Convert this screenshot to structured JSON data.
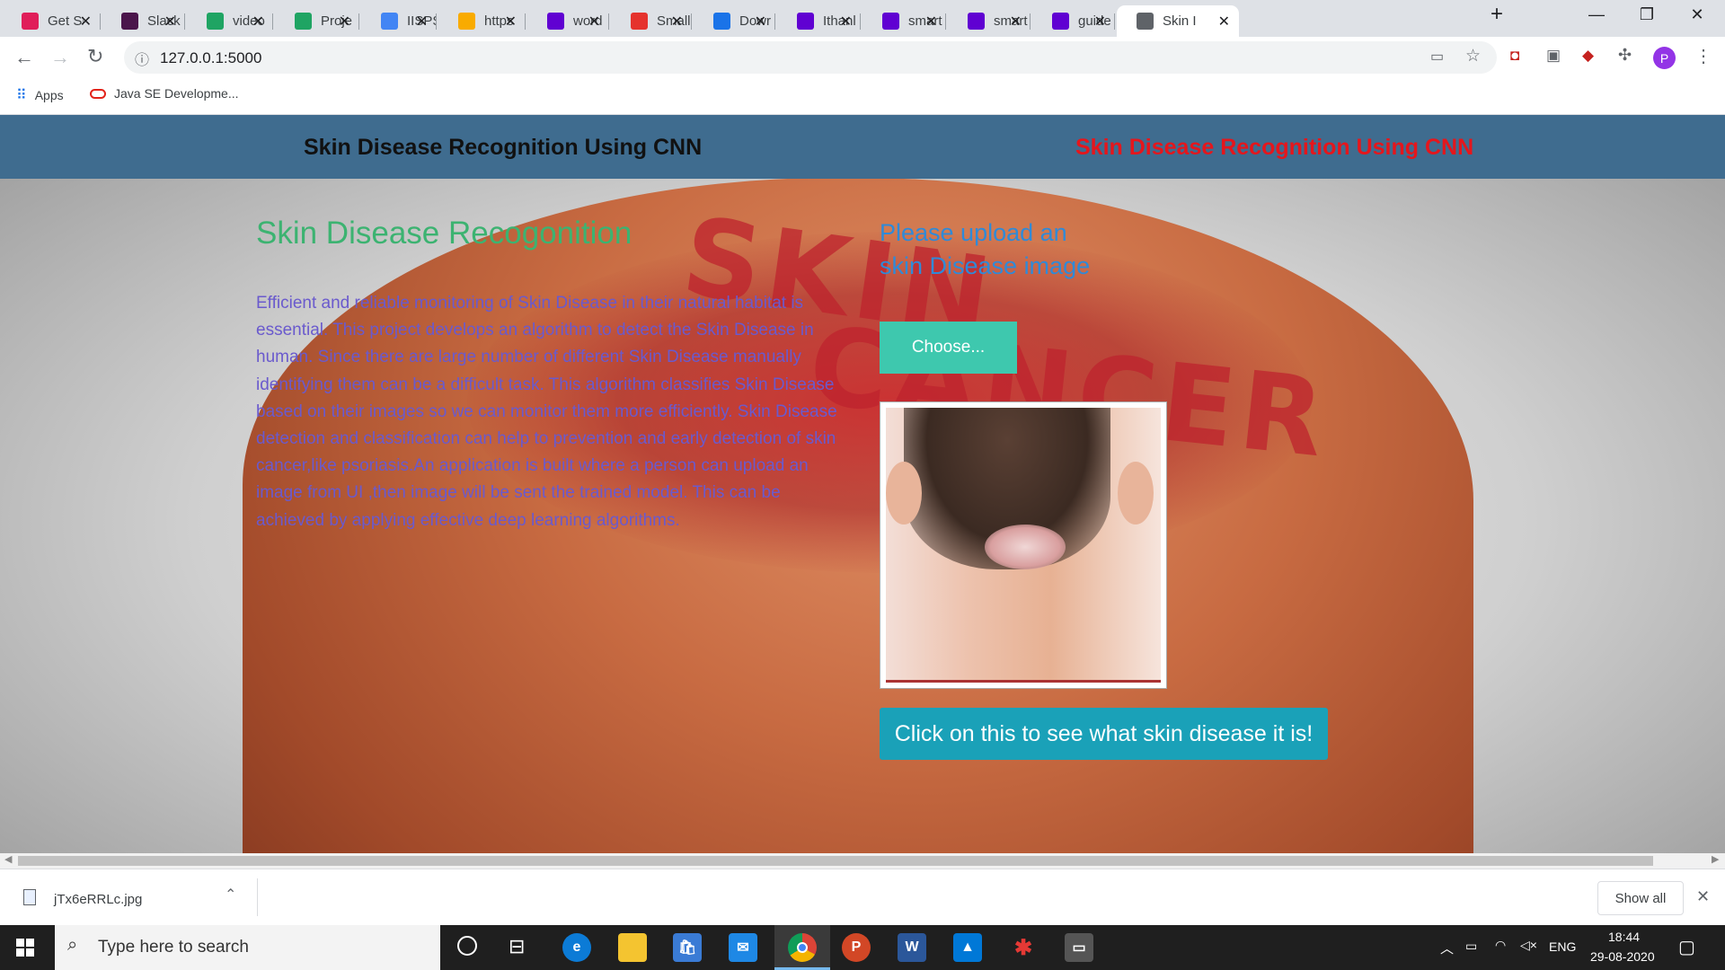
{
  "browser": {
    "tabs": [
      {
        "title": "Get St",
        "icon": "slack-icon",
        "color": "#e01e5a"
      },
      {
        "title": "Slack",
        "icon": "slack-app-icon",
        "color": "#4a154b"
      },
      {
        "title": "video",
        "icon": "google-drive-icon",
        "color": "#1fa463"
      },
      {
        "title": "Proje",
        "icon": "google-drive-icon",
        "color": "#1fa463"
      },
      {
        "title": "IISPS",
        "icon": "google-docs-icon",
        "color": "#4285f4"
      },
      {
        "title": "https",
        "icon": "colab-icon",
        "color": "#f9ab00"
      },
      {
        "title": "word",
        "icon": "yahoo-icon",
        "color": "#6001d2"
      },
      {
        "title": "Small",
        "icon": "smallpdf-icon",
        "color": "#e5322d"
      },
      {
        "title": "Dowr",
        "icon": "download-icon",
        "color": "#1a73e8"
      },
      {
        "title": "Ithanl",
        "icon": "yahoo-icon",
        "color": "#6001d2"
      },
      {
        "title": "smart",
        "icon": "yahoo-icon",
        "color": "#6001d2"
      },
      {
        "title": "smart",
        "icon": "yahoo-icon",
        "color": "#6001d2"
      },
      {
        "title": "guide",
        "icon": "yahoo-icon",
        "color": "#6001d2"
      },
      {
        "title": "Skin I",
        "icon": "globe-icon",
        "color": "#5f6368",
        "active": true
      }
    ],
    "url": "127.0.0.1:5000",
    "bookmarks": [
      {
        "label": "Apps",
        "icon": "apps-grid-icon"
      },
      {
        "label": "Java SE Developme...",
        "icon": "oracle-icon"
      }
    ],
    "profile_initial": "P"
  },
  "page": {
    "nav_brand": "Skin Disease Recognition Using CNN",
    "nav_brand_right": "Skin Disease Recognition Using CNN",
    "heading": "Skin Disease Recogonition",
    "description": "Efficient and reliable monitoring of Skin Disease in their natural habitat is essential. This project develops an algorithm to detect the Skin Disease in human. Since there are large number of different Skin Disease manually identifying them can be a difficult task. This algorithm classifies Skin Disease based on their images so we can monitor them more efficiently. Skin Disease detection and classification can help to prevention and early detection of skin cancer,like psoriasis.An application is built where a person can upload an image from UI ,then image will be sent the trained model. This can be achieved by applying effective deep learning algorithms.",
    "upload_heading": "Please upload an skin Disease image",
    "choose_label": "Choose...",
    "predict_label": "Click on this to see what skin disease it is!",
    "background_text": "SKIN CANCER"
  },
  "downloads": {
    "filename": "jTx6eRRLc.jpg",
    "show_all": "Show all"
  },
  "taskbar": {
    "search_placeholder": "Type here to search",
    "language": "ENG",
    "time": "18:44",
    "date": "29-08-2020"
  },
  "colors": {
    "navbar": "#3f6c8f",
    "heading": "#3cb371",
    "description": "#6a5acd",
    "upload_heading": "#2f8ad8",
    "choose_button": "#3ec8ae",
    "predict_button": "#1aa1b8",
    "brand_right": "#e5161c"
  }
}
